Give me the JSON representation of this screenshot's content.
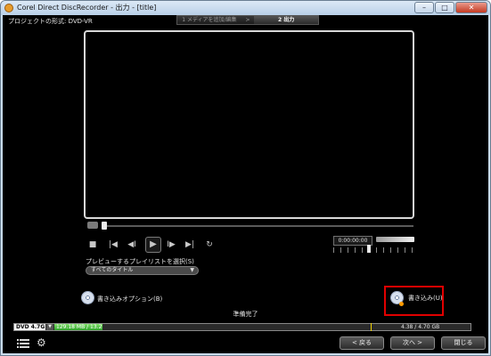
{
  "window": {
    "title": "Corel Direct DiscRecorder - 出力 - [title]",
    "minimize": "–",
    "maximize": "□",
    "close": "✕"
  },
  "header": {
    "project_format": "プロジェクトの形式: DVD-VR",
    "steps": [
      "1 メディアを追加/編集",
      ">",
      "2 出力"
    ]
  },
  "player": {
    "timecode": "0:00:00:00",
    "controls": [
      "■",
      "|◀",
      "◀I",
      "▶",
      "I▶",
      "▶|",
      "↻"
    ]
  },
  "playlist": {
    "label": "プレビューするプレイリストを選択(S)",
    "selected": "すべてのタイトル"
  },
  "actions": {
    "burn_options": "書き込みオプション(B)",
    "burn": "書き込み(U)"
  },
  "status": "準備完了",
  "capacity": {
    "disc_type": "DVD 4.7G",
    "used": "129.18 MB / 13.2 GB",
    "used_fraction": 0.12,
    "total": "4.38 / 4.70 GB"
  },
  "footer": {
    "back": "< 戻る",
    "next": "次へ >",
    "close": "閉じる"
  }
}
